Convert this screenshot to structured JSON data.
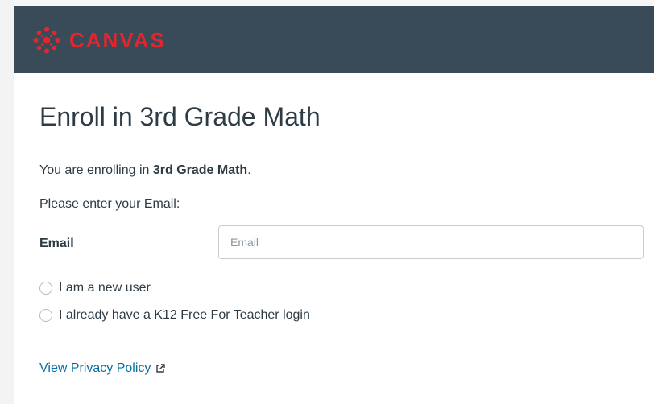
{
  "header": {
    "logo_text": "CANVAS",
    "brand_color": "#e4262c",
    "bar_color": "#394b58"
  },
  "page": {
    "title": "Enroll in 3rd Grade Math",
    "intro_prefix": "You are enrolling in ",
    "intro_course": "3rd Grade Math",
    "intro_suffix": ".",
    "prompt": "Please enter your Email:"
  },
  "form": {
    "email_label": "Email",
    "email_placeholder": "Email",
    "email_value": "",
    "options": [
      {
        "label": "I am a new user",
        "selected": false
      },
      {
        "label": "I already have a K12 Free For Teacher login",
        "selected": false
      }
    ]
  },
  "footer": {
    "privacy_link": "View Privacy Policy",
    "privacy_icon": "external-link-icon"
  },
  "icons": {
    "logo": "canvas-logo-icon",
    "radio": "radio-icon"
  }
}
